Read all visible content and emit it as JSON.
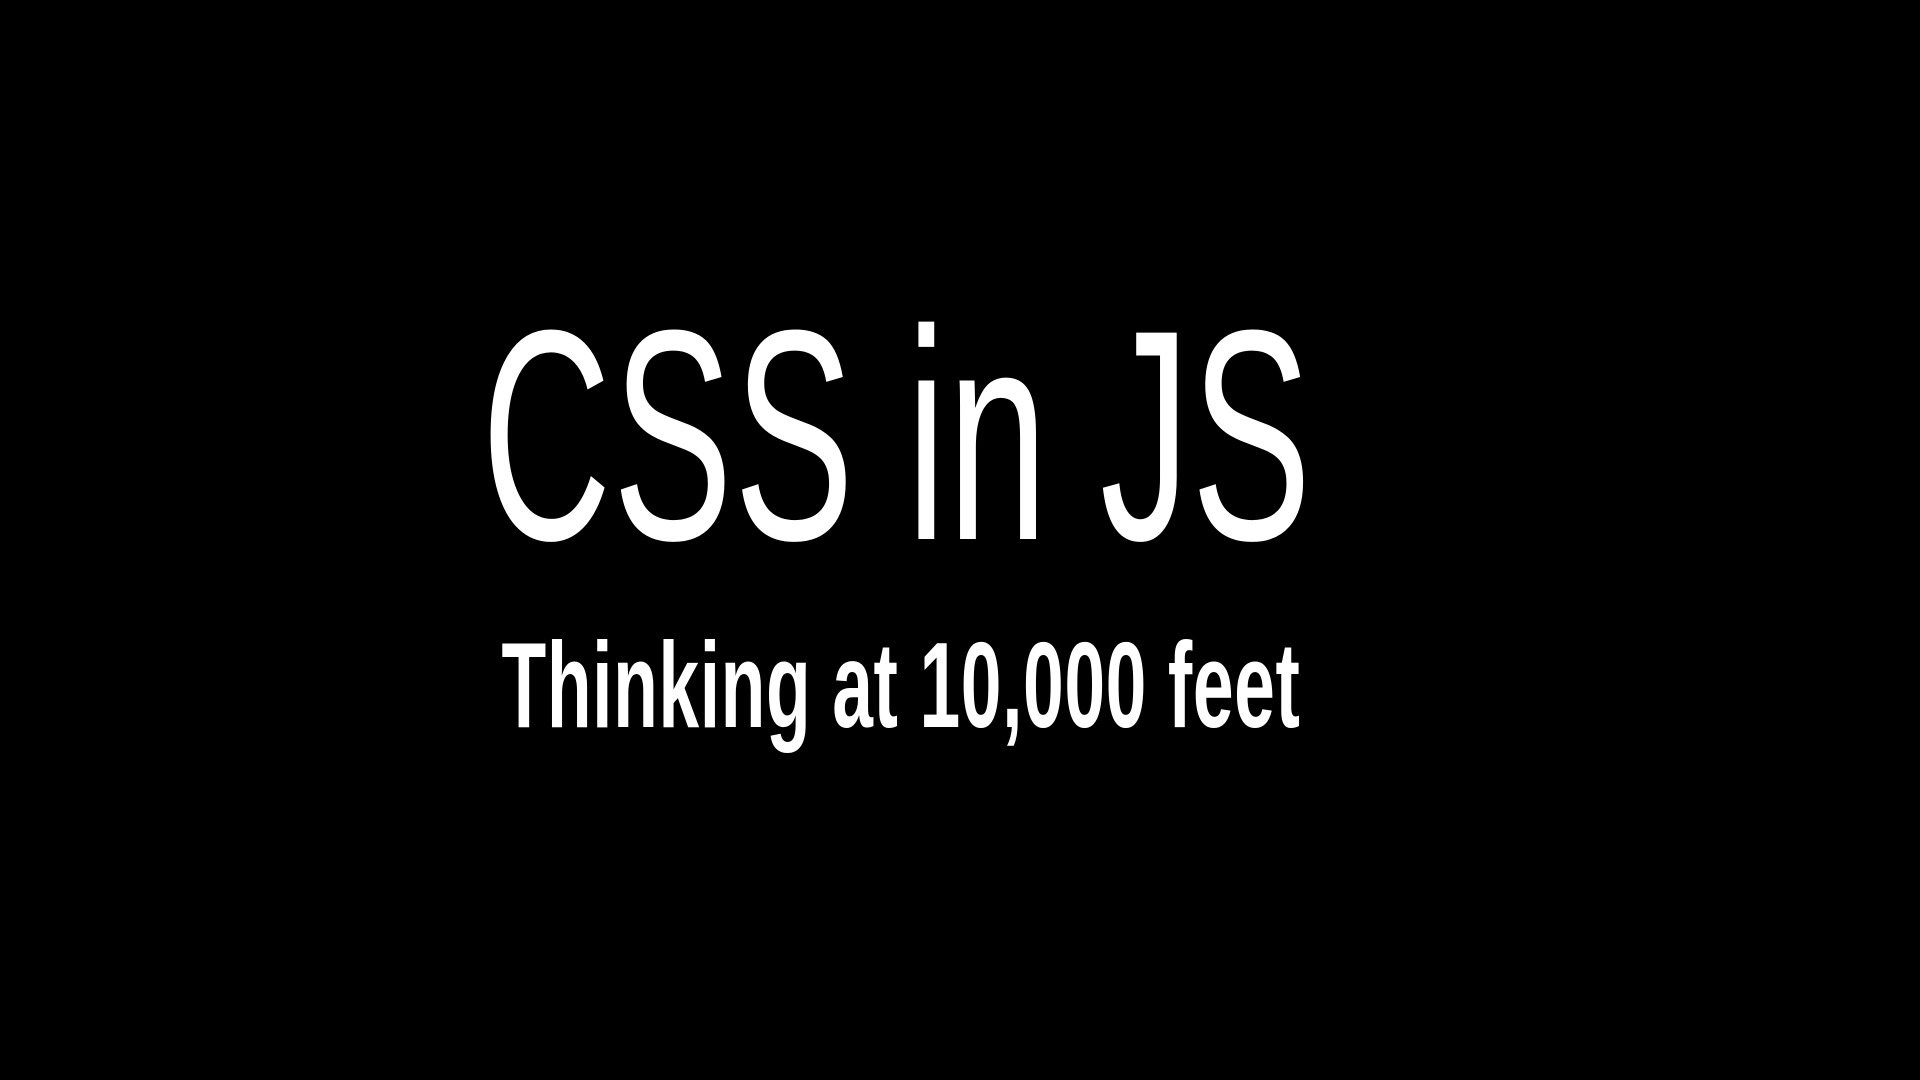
{
  "slide": {
    "title": "CSS in JS",
    "subtitle": "Thinking at 10,000 feet",
    "colors": {
      "background": "#000000",
      "text": "#ffffff"
    }
  }
}
